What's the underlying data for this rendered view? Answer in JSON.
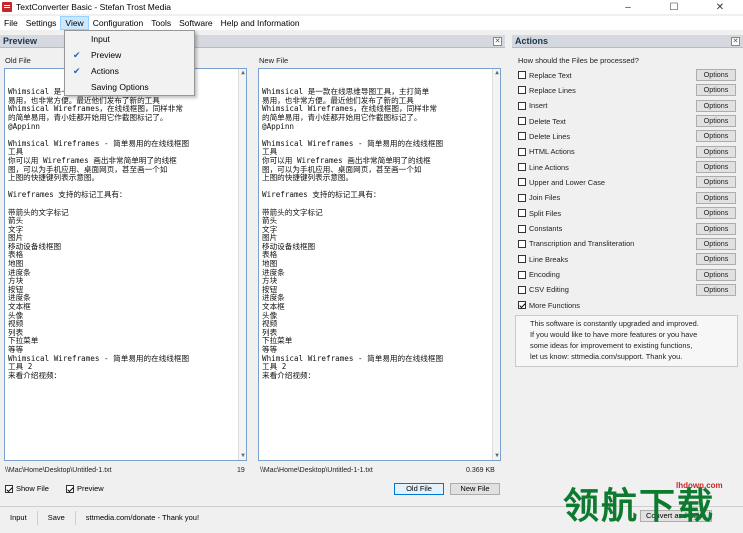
{
  "window": {
    "title": "TextConverter Basic - Stefan Trost Media"
  },
  "menu": [
    "File",
    "Settings",
    "View",
    "Configuration",
    "Tools",
    "Software",
    "Help and Information"
  ],
  "view_menu": [
    {
      "label": "Input",
      "checked": false
    },
    {
      "label": "Preview",
      "checked": true
    },
    {
      "label": "Actions",
      "checked": true
    },
    {
      "label": "Saving Options",
      "checked": false
    }
  ],
  "preview": {
    "header": "Preview",
    "old_file_label": "Old File",
    "new_file_label": "New File",
    "old_text": [
      "Whimsical 是一款在线思维导图工具，主打简单",
      "易用，也非常方便。最近他们发布了新的工具",
      "Whimsical Wireframes，在线线框图，同样非常",
      "的简单易用，青小娃都开始用它作截图标记了。",
      "@Appinn",
      "",
      "Whimsical Wireframes - 简单易用的在线线框图",
      "工具",
      "你可以用 Wireframes 画出非常简单明了的线框",
      "图，可以为手机应用、桌面网页，甚至画一个如",
      "上图的快捷键列表示意图。",
      "",
      "Wireframes 支持的标记工具有：",
      "",
      "带箭头的文字标记",
      "箭头",
      "文字",
      "图片",
      "移动设备线框图",
      "表格",
      "地图",
      "进度条",
      "方块",
      "按钮",
      "进度条",
      "文本框",
      "头像",
      "视频",
      "列表",
      "下拉菜单",
      "等等",
      "Whimsical Wireframes - 简单易用的在线线框图",
      "工具 2",
      "来看介绍视频："
    ],
    "new_text": [
      "Whimsical 是一款在线思维导图工具，主打简单",
      "易用，也非常方便。最近他们发布了新的工具",
      "Whimsical Wireframes，在线线框图，同样非常",
      "的简单易用，青小娃都开始用它作截图标记了。",
      "@Appinn",
      "",
      "Whimsical Wireframes - 简单易用的在线线框图",
      "工具",
      "你可以用 Wireframes 画出非常简单明了的线框",
      "图，可以为手机应用、桌面网页，甚至画一个如",
      "上图的快捷键列表示意图。",
      "",
      "Wireframes 支持的标记工具有：",
      "",
      "带箭头的文字标记",
      "箭头",
      "文字",
      "图片",
      "移动设备线框图",
      "表格",
      "地图",
      "进度条",
      "方块",
      "按钮",
      "进度条",
      "文本框",
      "头像",
      "视频",
      "列表",
      "下拉菜单",
      "等等",
      "Whimsical Wireframes - 简单易用的在线线框图",
      "工具 2",
      "来看介绍视频："
    ],
    "old_path": "\\\\Mac\\Home\\Desktop\\Untitled-1.txt",
    "old_count": "19",
    "new_path": "\\\\Mac\\Home\\Desktop\\Untitled-1-1.txt",
    "new_size": "0.369 KB",
    "show_file_label": "Show File",
    "preview_label": "Preview",
    "old_file_button": "Old File",
    "new_file_button": "New File"
  },
  "actions": {
    "header": "Actions",
    "question": "How should the Files be processed?",
    "options_label": "Options",
    "items": [
      {
        "label": "Replace Text",
        "checked": false
      },
      {
        "label": "Replace Lines",
        "checked": false
      },
      {
        "label": "Insert",
        "checked": false
      },
      {
        "label": "Delete Text",
        "checked": false
      },
      {
        "label": "Delete Lines",
        "checked": false
      },
      {
        "label": "HTML Actions",
        "checked": false
      },
      {
        "label": "Line Actions",
        "checked": false
      },
      {
        "label": "Upper and Lower Case",
        "checked": false
      },
      {
        "label": "Join Files",
        "checked": false
      },
      {
        "label": "Split Files",
        "checked": false
      },
      {
        "label": "Constants",
        "checked": false
      },
      {
        "label": "Transcription and Transliteration",
        "checked": false
      },
      {
        "label": "Line Breaks",
        "checked": false
      },
      {
        "label": "Encoding",
        "checked": false
      },
      {
        "label": "CSV Editing",
        "checked": false
      }
    ],
    "more_functions": {
      "label": "More Functions",
      "checked": true
    },
    "info_lines": [
      "This software is constantly upgraded and improved.",
      "If you would like to have more features or you have",
      "some ideas for improvement to existing functions,",
      "let us know: sttmedia.com/support. Thank you."
    ]
  },
  "bottom": {
    "input": "Input",
    "save": "Save",
    "donate": "sttmedia.com/donate - Thank you!",
    "convert_save": "Convert and Save"
  },
  "watermark": {
    "text": "领航下载",
    "sub": "lhdown.com"
  }
}
